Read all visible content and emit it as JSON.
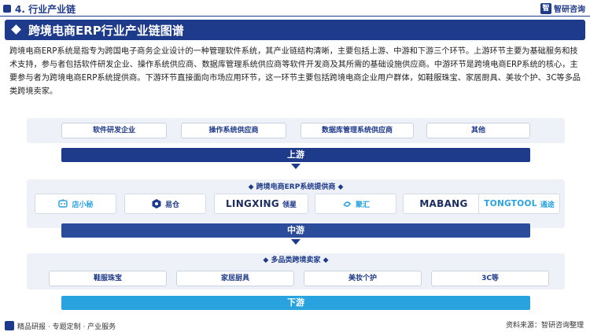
{
  "header": {
    "section": "4. 行业产业链",
    "brand": "智研咨询",
    "brand_mark": "智"
  },
  "title": "跨境电商ERP行业产业链图谱",
  "intro": "跨境电商ERP系统是指专为跨国电子商务企业设计的一种管理软件系统，其产业链结构清晰，主要包括上游、中游和下游三个环节。上游环节主要为基础服务和技术支持，参与者包括软件研发企业、操作系统供应商、数据库管理系统供应商等软件开发商及其所需的基础设施供应商。中游环节是跨境电商ERP系统的核心，主要参与者为跨境电商ERP系统提供商。下游环节直接面向市场应用环节，这一环节主要包括跨境电商企业用户群体，如鞋服珠宝、家居厨具、美妆个护、3C等多品类跨境卖家。",
  "upstream": {
    "items": [
      "软件研发企业",
      "操作系统供应商",
      "数据库管理系统供应商",
      "其他"
    ],
    "stage_label": "上游"
  },
  "midstream": {
    "group_title": "跨境电商ERP系统提供商",
    "vendors": [
      {
        "name": "店小秘",
        "icon": "robot-icon"
      },
      {
        "name": "易仓",
        "icon": "hexagon-icon"
      },
      {
        "name": "LINGXING",
        "suffix": "领星",
        "icon": "none"
      },
      {
        "name": "马帮",
        "suffix": "聚汇",
        "icon": "swirl-icon"
      },
      {
        "name": "MABANG",
        "icon": "none"
      },
      {
        "name": "TONGTOOL",
        "suffix": "通途",
        "icon": "none"
      }
    ],
    "stage_label": "中游"
  },
  "downstream": {
    "group_title": "多品类跨境卖家",
    "items": [
      "鞋服珠宝",
      "家居厨具",
      "美妆个护",
      "3C等"
    ],
    "stage_label": "下游"
  },
  "footer": {
    "left": "精品研报 · 专题定制 · 产业服务",
    "right": "资料来源：智研咨询整理"
  },
  "colors": {
    "primary": "#1e3a8a",
    "accent": "#29a3e0",
    "panel": "#eef2f8"
  }
}
